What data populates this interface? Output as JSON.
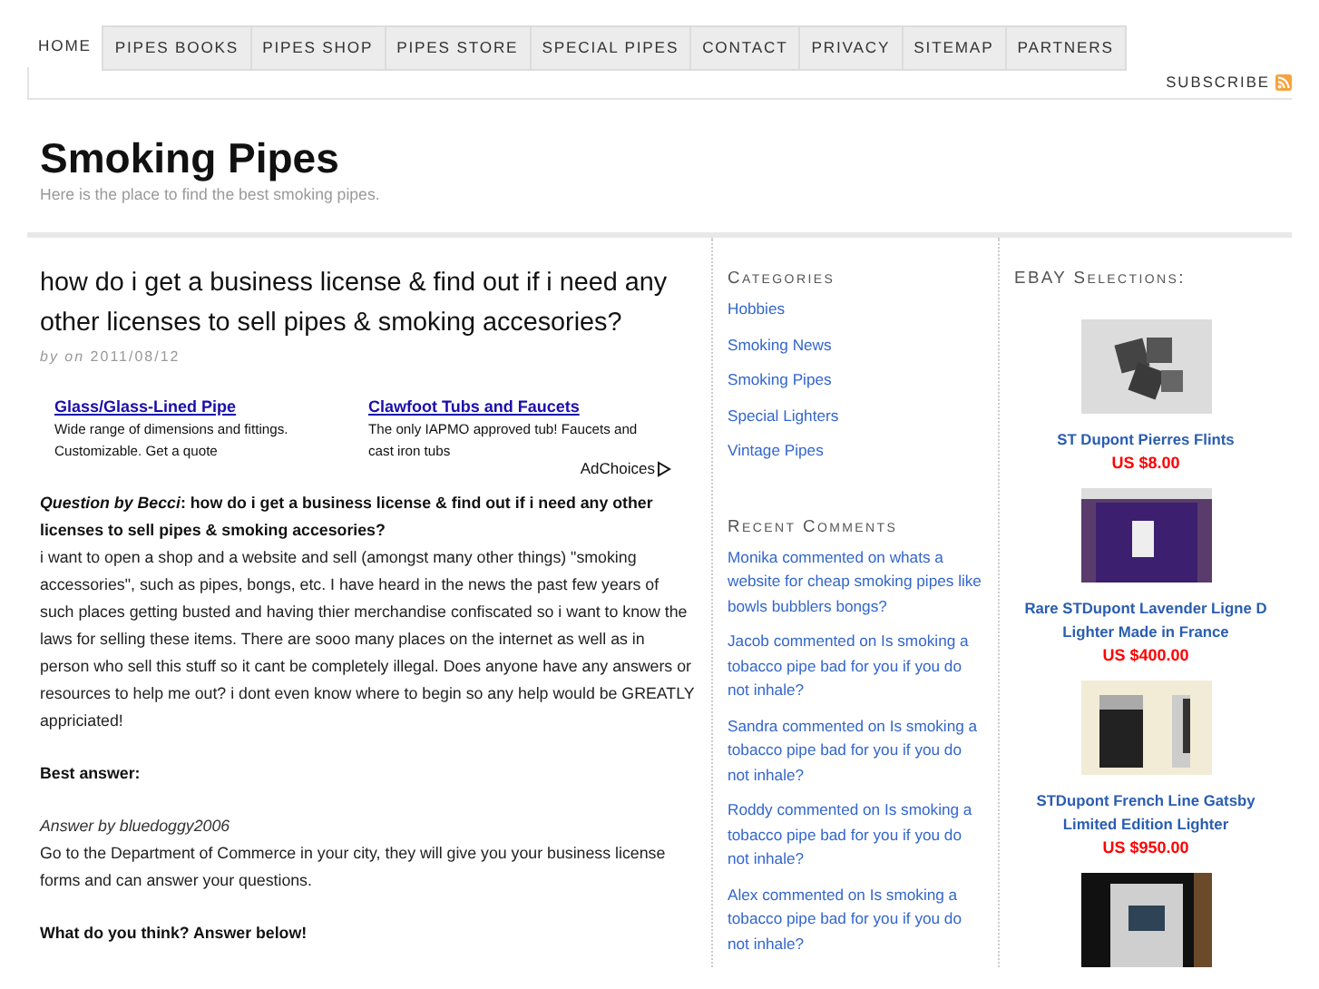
{
  "nav": {
    "items": [
      {
        "label": "HOME",
        "selected": true
      },
      {
        "label": "PIPES BOOKS",
        "selected": false
      },
      {
        "label": "PIPES SHOP",
        "selected": false
      },
      {
        "label": "PIPES STORE",
        "selected": false
      },
      {
        "label": "SPECIAL PIPES",
        "selected": false
      },
      {
        "label": "CONTACT",
        "selected": false
      },
      {
        "label": "PRIVACY",
        "selected": false
      },
      {
        "label": "SITEMAP",
        "selected": false
      },
      {
        "label": "PARTNERS",
        "selected": false
      }
    ],
    "subscribe": "SUBSCRIBE"
  },
  "header": {
    "title": "Smoking Pipes",
    "tagline": "Here is the place to find the best smoking pipes."
  },
  "post": {
    "title": "how do i get a business license & find out if i need any other licenses to sell pipes & smoking accesories?",
    "meta": "*by on* 2011/08/12",
    "ads": [
      {
        "title": "Glass/Glass-Lined Pipe",
        "text": "Wide range of dimensions and fittings. Customizable. Get a quote"
      },
      {
        "title": "Clawfoot Tubs and Faucets",
        "text": "The only IAPMO approved tub! Faucets and cast iron tubs"
      }
    ],
    "ad_choices": "AdChoices",
    "question": "*Question by Becci*: how do i get a business license & find out if i need any other licenses to sell pipes & smoking accesories?",
    "body": "i want to open a shop and a website and sell (amongst many other things) \"smoking accessories\", such as pipes, bongs, etc. I have heard in the news the past few years of such places getting busted and having thier merchandise confiscated so i want to know the laws for selling these items. There are sooo many places on the internet as well as in person who sell this stuff so it cant be completely illegal. Does anyone have any answers or resources to help me out? i dont even know where to begin so any help would be GREATLY appriciated!",
    "best_answer_label": "Best answer:",
    "answer_by": "Answer by bluedoggy2006",
    "answer": "Go to the Department of Commerce in your city, they will give you your business license forms and can answer your questions.",
    "closing": "What do you think? Answer below!"
  },
  "categories": {
    "heading": "Categories",
    "items": [
      "Hobbies",
      "Smoking News",
      "Smoking Pipes",
      "Special Lighters",
      "Vintage Pipes"
    ]
  },
  "recent_comments": {
    "heading": "Recent Comments",
    "items": [
      "Monika commented on whats a website for cheap smoking pipes like bowls bubblers bongs?",
      "Jacob commented on Is smoking a tobacco pipe bad for you if you do not inhale?",
      "Sandra commented on Is smoking a tobacco pipe bad for you if you do not inhale?",
      "Roddy commented on Is smoking a tobacco pipe bad for you if you do not inhale?",
      "Alex commented on Is smoking a tobacco pipe bad for you if you do not inhale?"
    ]
  },
  "ebay": {
    "heading": "EBAY Selections:",
    "items": [
      {
        "kind": "picture",
        "title": "ST Dupont Pierres Flints",
        "price": "US $8.00"
      },
      {
        "kind": "picture",
        "title": "Rare STDupont Lavender Ligne D Lighter Made in France",
        "price": "US $400.00"
      },
      {
        "kind": "picture",
        "title": "STDupont French Line Gatsby Limited Edition Lighter",
        "price": "US $950.00"
      },
      {
        "kind": "picture"
      }
    ]
  }
}
